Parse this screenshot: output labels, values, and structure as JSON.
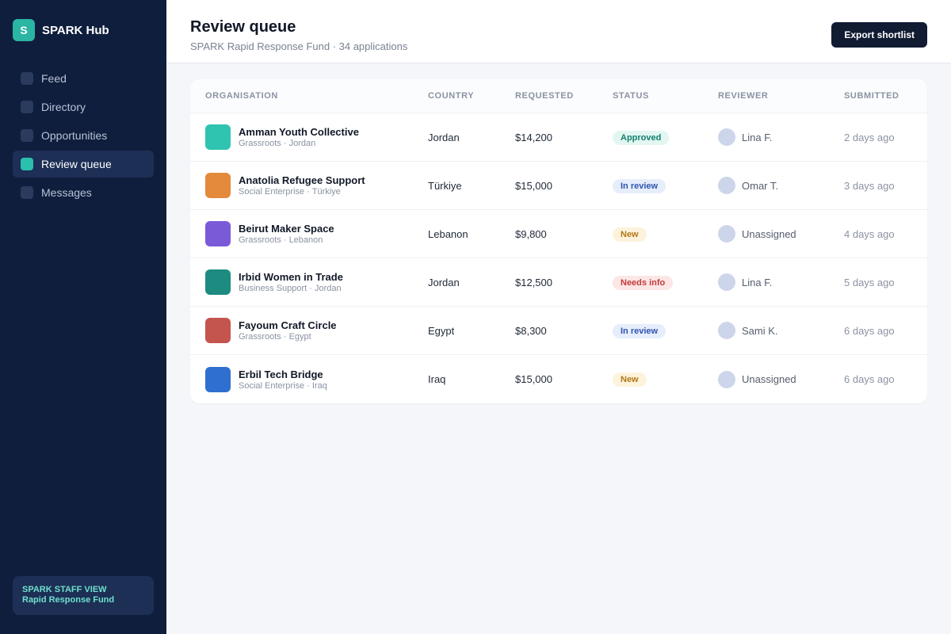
{
  "app": {
    "logo_letter": "S",
    "name": "SPARK Hub"
  },
  "sidebar": {
    "items": [
      {
        "label": "Feed",
        "active": false
      },
      {
        "label": "Directory",
        "active": false
      },
      {
        "label": "Opportunities",
        "active": false
      },
      {
        "label": "Review queue",
        "active": true
      },
      {
        "label": "Messages",
        "active": false
      }
    ],
    "staff_card": {
      "line1": "SPARK STAFF VIEW",
      "line2": "Rapid Response Fund"
    }
  },
  "header": {
    "title": "Review queue",
    "subtitle": "SPARK Rapid Response Fund · 34 applications",
    "export_label": "Export shortlist"
  },
  "table": {
    "columns": [
      "ORGANISATION",
      "COUNTRY",
      "REQUESTED",
      "STATUS",
      "REVIEWER",
      "SUBMITTED"
    ],
    "rows": [
      {
        "name": "Amman Youth Collective",
        "meta": "Grassroots · Jordan",
        "color": "#2ec4b0",
        "country": "Jordan",
        "requested": "$14,200",
        "status": "Approved",
        "status_key": "approved",
        "reviewer": "Lina F.",
        "submitted": "2 days ago"
      },
      {
        "name": "Anatolia Refugee Support",
        "meta": "Social Enterprise · Türkiye",
        "color": "#e38a3c",
        "country": "Türkiye",
        "requested": "$15,000",
        "status": "In review",
        "status_key": "review",
        "reviewer": "Omar T.",
        "submitted": "3 days ago"
      },
      {
        "name": "Beirut Maker Space",
        "meta": "Grassroots · Lebanon",
        "color": "#7b5ad8",
        "country": "Lebanon",
        "requested": "$9,800",
        "status": "New",
        "status_key": "new",
        "reviewer": "Unassigned",
        "submitted": "4 days ago"
      },
      {
        "name": "Irbid Women in Trade",
        "meta": "Business Support · Jordan",
        "color": "#1d8b80",
        "country": "Jordan",
        "requested": "$12,500",
        "status": "Needs info",
        "status_key": "info",
        "reviewer": "Lina F.",
        "submitted": "5 days ago"
      },
      {
        "name": "Fayoum Craft Circle",
        "meta": "Grassroots · Egypt",
        "color": "#c4544e",
        "country": "Egypt",
        "requested": "$8,300",
        "status": "In review",
        "status_key": "review",
        "reviewer": "Sami K.",
        "submitted": "6 days ago"
      },
      {
        "name": "Erbil Tech Bridge",
        "meta": "Social Enterprise · Iraq",
        "color": "#2f6fd0",
        "country": "Iraq",
        "requested": "$15,000",
        "status": "New",
        "status_key": "new",
        "reviewer": "Unassigned",
        "submitted": "6 days ago"
      }
    ]
  },
  "status_colors": {
    "approved": {
      "bg": "#e3f6f1",
      "fg": "#13806f"
    },
    "review": {
      "bg": "#e6edfb",
      "fg": "#2f55b0"
    },
    "new": {
      "bg": "#fdf3dc",
      "fg": "#b07818"
    },
    "info": {
      "bg": "#fce6e6",
      "fg": "#c23c3c"
    }
  }
}
